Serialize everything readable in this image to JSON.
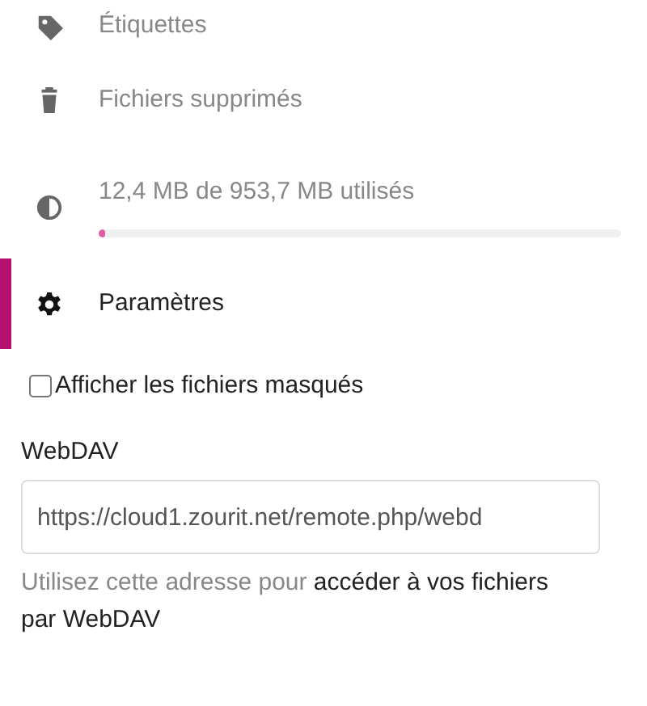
{
  "navigation": {
    "items": [
      {
        "kind": "tag",
        "label": "Étiquettes",
        "selected": false
      },
      {
        "kind": "trash",
        "label": "Fichiers supprimés",
        "selected": false
      },
      {
        "kind": "quota",
        "label": "12,4 MB de 953,7 MB utilisés",
        "level": 0.013,
        "selected": false
      },
      {
        "kind": "gear",
        "label": "Paramètres",
        "selected": true
      }
    ]
  },
  "settings": {
    "hidden_files": {
      "label": "Afficher les fichiers masqués",
      "checked": false
    },
    "webdav": {
      "label": "WebDAV",
      "value": "https://cloud1.zourit.net/remote.php/webd",
      "hint": "Utilisez cette adresse pour ",
      "link_lines": [
        "accéder à vos fichiers",
        "par WebDAV"
      ]
    }
  }
}
